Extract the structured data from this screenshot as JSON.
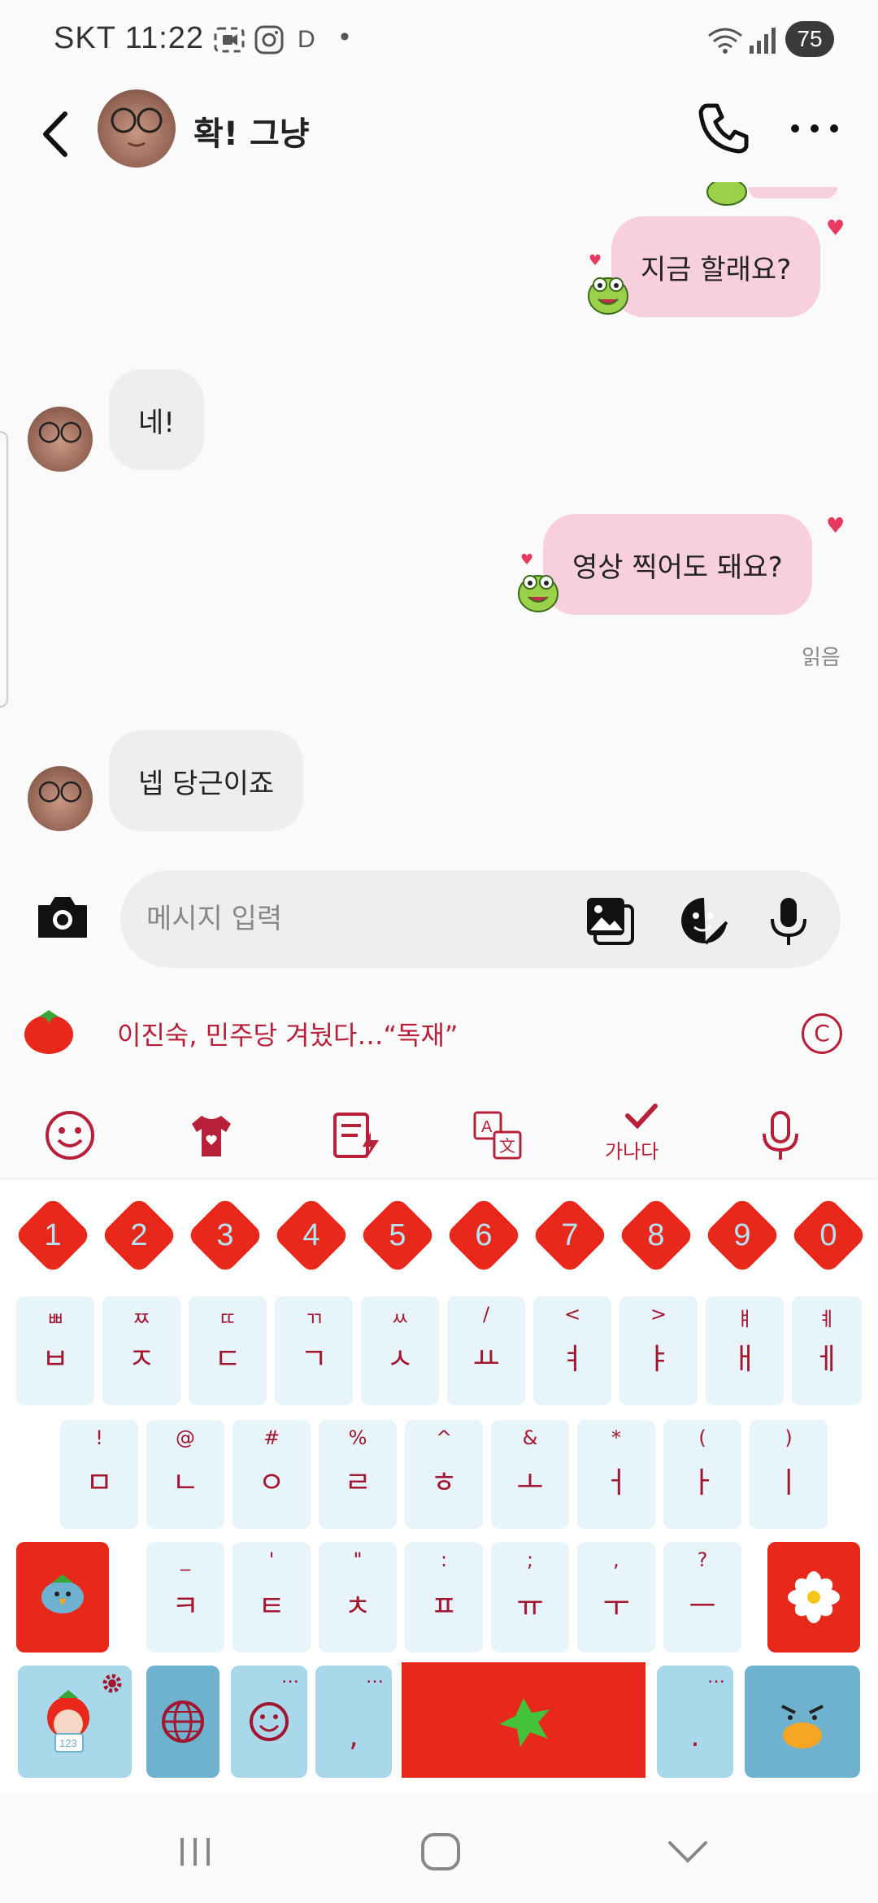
{
  "status_bar": {
    "time": "SKT 11:22",
    "indicator": "D",
    "battery": "75"
  },
  "header": {
    "contact_name": "확! 그냥"
  },
  "messages": [
    {
      "side": "out",
      "text": "지금 할래요?"
    },
    {
      "side": "in",
      "text": "네!"
    },
    {
      "side": "out",
      "text": "영상 찍어도 돼요?"
    },
    {
      "side": "in",
      "text": "넵 당근이죠"
    }
  ],
  "read_label": "읽음",
  "input": {
    "placeholder": "메시지 입력"
  },
  "news": {
    "headline": "이진숙, 민주당 겨눴다…“독재”"
  },
  "keyboard_toolbar": {
    "language_label": "가나다"
  },
  "keyboard": {
    "numbers": [
      "1",
      "2",
      "3",
      "4",
      "5",
      "6",
      "7",
      "8",
      "9",
      "0"
    ],
    "row1": [
      {
        "main": "ㅂ",
        "sub": "ㅃ"
      },
      {
        "main": "ㅈ",
        "sub": "ㅉ"
      },
      {
        "main": "ㄷ",
        "sub": "ㄸ"
      },
      {
        "main": "ㄱ",
        "sub": "ㄲ"
      },
      {
        "main": "ㅅ",
        "sub": "ㅆ"
      },
      {
        "main": "ㅛ",
        "sub": "/"
      },
      {
        "main": "ㅕ",
        "sub": "<"
      },
      {
        "main": "ㅑ",
        "sub": ">"
      },
      {
        "main": "ㅐ",
        "sub": "ㅒ"
      },
      {
        "main": "ㅔ",
        "sub": "ㅖ"
      }
    ],
    "row2": [
      {
        "main": "ㅁ",
        "sub": "!"
      },
      {
        "main": "ㄴ",
        "sub": "@"
      },
      {
        "main": "ㅇ",
        "sub": "#"
      },
      {
        "main": "ㄹ",
        "sub": "%"
      },
      {
        "main": "ㅎ",
        "sub": "^"
      },
      {
        "main": "ㅗ",
        "sub": "&"
      },
      {
        "main": "ㅓ",
        "sub": "*"
      },
      {
        "main": "ㅏ",
        "sub": "("
      },
      {
        "main": "ㅣ",
        "sub": ")"
      }
    ],
    "row3": [
      {
        "main": "ㅋ",
        "sub": "_"
      },
      {
        "main": "ㅌ",
        "sub": "'"
      },
      {
        "main": "ㅊ",
        "sub": "\""
      },
      {
        "main": "ㅍ",
        "sub": ":"
      },
      {
        "main": "ㅠ",
        "sub": ";"
      },
      {
        "main": "ㅜ",
        "sub": ","
      },
      {
        "main": "ㅡ",
        "sub": "?"
      }
    ],
    "comma_key": ",",
    "period_key": ".",
    "ellipsis": "…"
  },
  "colors": {
    "bubble_out": "#f8cfdc",
    "bubble_in": "#efedef",
    "accent_red": "#b8203a",
    "key_red": "#e8281a",
    "key_light": "#e7f5fb"
  }
}
